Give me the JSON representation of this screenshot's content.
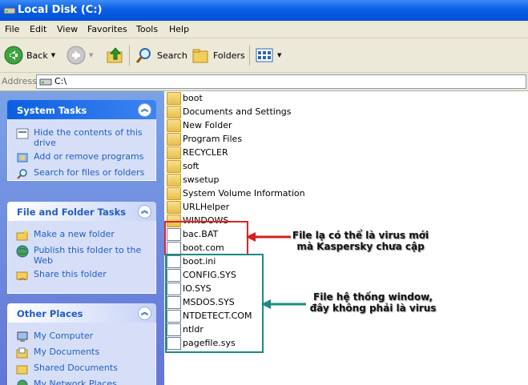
{
  "window": {
    "title": "Local Disk (C:)"
  },
  "menu": {
    "items": [
      "File",
      "Edit",
      "View",
      "Favorites",
      "Tools",
      "Help"
    ]
  },
  "toolbar": {
    "back": "Back",
    "search": "Search",
    "folders": "Folders"
  },
  "address": {
    "label": "Address",
    "value": "C:\\"
  },
  "left_pane": {
    "system_tasks": {
      "title": "System Tasks",
      "items": [
        "Hide the contents of this drive",
        "Add or remove programs",
        "Search for files or folders"
      ]
    },
    "file_folder_tasks": {
      "title": "File and Folder Tasks",
      "items": [
        "Make a new folder",
        "Publish this folder to the Web",
        "Share this folder"
      ]
    },
    "other_places": {
      "title": "Other Places",
      "items": [
        "My Computer",
        "My Documents",
        "Shared Documents",
        "My Network Places"
      ]
    }
  },
  "files": [
    {
      "name": "boot",
      "type": "folder"
    },
    {
      "name": "Documents and Settings",
      "type": "folder"
    },
    {
      "name": "New Folder",
      "type": "folder"
    },
    {
      "name": "Program Files",
      "type": "folder"
    },
    {
      "name": "RECYCLER",
      "type": "folder"
    },
    {
      "name": "soft",
      "type": "folder"
    },
    {
      "name": "swsetup",
      "type": "folder"
    },
    {
      "name": "System Volume Information",
      "type": "folder"
    },
    {
      "name": "URLHelper",
      "type": "folder"
    },
    {
      "name": "WINDOWS",
      "type": "folder"
    },
    {
      "name": "bac.BAT",
      "type": "file"
    },
    {
      "name": "boot.com",
      "type": "file"
    },
    {
      "name": "boot.ini",
      "type": "file"
    },
    {
      "name": "CONFIG.SYS",
      "type": "file"
    },
    {
      "name": "IO.SYS",
      "type": "file"
    },
    {
      "name": "MSDOS.SYS",
      "type": "file"
    },
    {
      "name": "NTDETECT.COM",
      "type": "file"
    },
    {
      "name": "ntldr",
      "type": "file"
    },
    {
      "name": "pagefile.sys",
      "type": "file"
    }
  ],
  "annotations": {
    "red": {
      "line1": "File lạ có thể là virus mới",
      "line2": "mà Kaspersky chưa cập",
      "color": "#e52222"
    },
    "teal": {
      "line1": "File hệ thống window,",
      "line2": "đây không phải là virus",
      "color": "#1b8a84"
    }
  }
}
